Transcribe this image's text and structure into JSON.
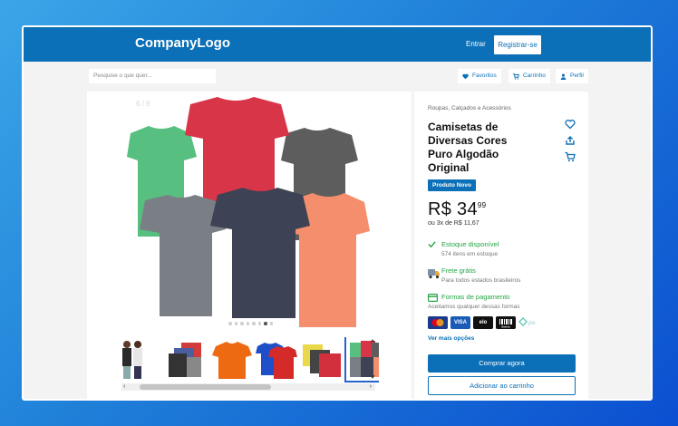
{
  "header": {
    "logo": "CompanyLogo",
    "login_label": "Entrar",
    "register_label": "Registrar-se"
  },
  "search": {
    "placeholder": "Pesquise o que quer..."
  },
  "nav": {
    "favorites": "Favoritos",
    "cart": "Carrinho",
    "profile": "Perfil"
  },
  "gallery": {
    "counter": "6 / 9",
    "dots_total": 8,
    "dots_active_index": 6,
    "thumbnails": [
      {
        "name": "models-thumbnail"
      },
      {
        "name": "stacked-shirts-thumbnail"
      },
      {
        "name": "orange-shirt-thumbnail"
      },
      {
        "name": "red-blue-shirts-thumbnail"
      },
      {
        "name": "yellow-red-shirts-thumbnail"
      },
      {
        "name": "assorted-shirts-thumbnail",
        "selected": true
      }
    ]
  },
  "product": {
    "breadcrumb": "Roupas, Calçados e Acessórios",
    "title": "Camisetas de Diversas Cores Puro Algodão Original",
    "badge": "Produto Novo",
    "price_main": "R$ 34",
    "price_cents": "99",
    "installments": "ou 3x de R$ 11,67",
    "stock_title": "Estoque disponível",
    "stock_sub": "574 itens em estoque",
    "shipping_title": "Frete grátis",
    "shipping_sub": "Para todos estados brasileiros",
    "payment_title": "Formas de pagamento",
    "payment_sub": "Aceitamos qualquer dessas formas",
    "payment_methods": [
      "Mastercard",
      "VISA",
      "elo",
      "Boleto",
      "Pix"
    ],
    "more_options": "Ver mais opções",
    "buy_now": "Comprar agora",
    "add_to_cart": "Adicionar ao carrinho"
  },
  "colors": {
    "brand": "#0b70b7",
    "success": "#24a644"
  }
}
